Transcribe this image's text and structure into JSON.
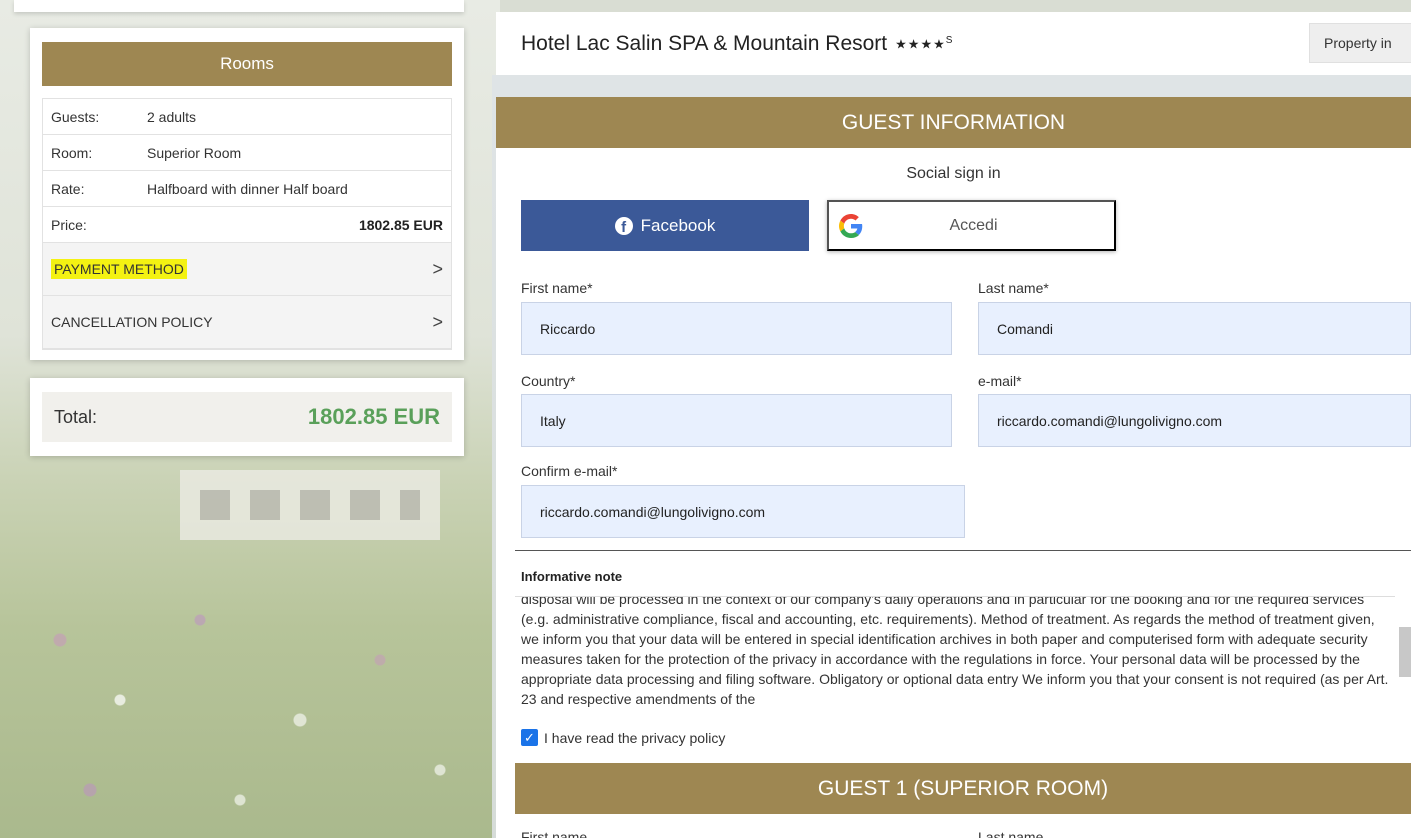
{
  "hotel": {
    "name": "Hotel Lac Salin SPA & Mountain Resort",
    "stars": "★★★★",
    "stars_suffix": "S",
    "property_button": "Property in"
  },
  "rooms_card": {
    "title": "Rooms",
    "rows": [
      {
        "label": "Guests:",
        "value": "2 adults"
      },
      {
        "label": "Room:",
        "value": "Superior Room"
      },
      {
        "label": "Rate:",
        "value": "Halfboard with dinner Half board"
      }
    ],
    "price_label": "Price:",
    "price_value": "1802.85 EUR",
    "payment_method": "PAYMENT METHOD",
    "cancellation_policy": "CANCELLATION POLICY",
    "chevron": ">"
  },
  "total": {
    "label": "Total:",
    "value": "1802.85 EUR"
  },
  "guest_info": {
    "title": "GUEST INFORMATION",
    "social_title": "Social sign in",
    "facebook_label": "Facebook",
    "google_label": "Accedi",
    "fields": {
      "first_name": {
        "label": "First name*",
        "value": "Riccardo"
      },
      "last_name": {
        "label": "Last name*",
        "value": "Comandi"
      },
      "country": {
        "label": "Country*",
        "value": "Italy"
      },
      "email": {
        "label": "e-mail*",
        "value": "riccardo.comandi@lungolivigno.com"
      },
      "confirm_email": {
        "label": "Confirm e-mail*",
        "value": "riccardo.comandi@lungolivigno.com"
      }
    },
    "informative_note_title": "Informative note",
    "informative_note_text": "disposal will be processed in the context of our company's daily operations and in particular for the booking and for the required services (e.g. administrative compliance, fiscal and accounting, etc. requirements). Method of treatment. As regards the method of treatment given, we inform you that your data will be entered in special identification archives in both paper and computerised form with adequate security measures taken for the protection of the privacy in accordance with the regulations in force. Your personal data will be processed by the appropriate data processing and filing software. Obligatory or optional data entry We inform you that your consent is not required (as per Art. 23 and respective amendments of the",
    "privacy_label": "I have read the privacy policy",
    "privacy_checked": true
  },
  "guest1": {
    "title": "GUEST 1 (SUPERIOR ROOM)",
    "first_label": "First name",
    "last_label": "Last name"
  },
  "colors": {
    "gold": "#9e8752",
    "facebook": "#3b5998",
    "total_green": "#5aa05a",
    "highlight": "#f4f212",
    "input_bg": "#e8f0fe"
  }
}
